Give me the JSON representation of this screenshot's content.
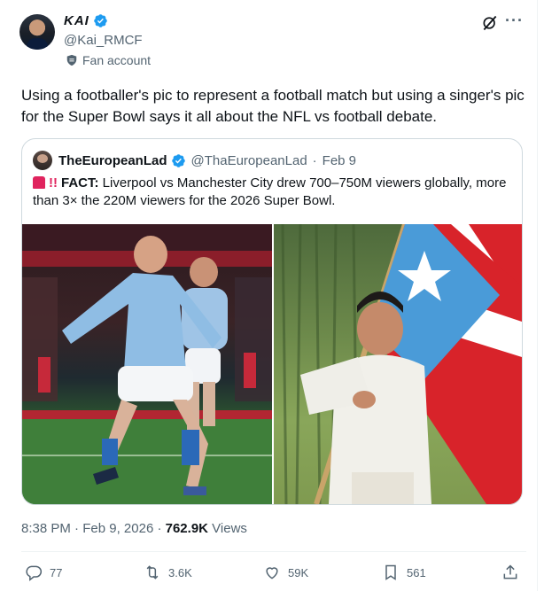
{
  "author": {
    "display_name": "KAI",
    "handle": "@Kai_RMCF",
    "label": "Fan account"
  },
  "tweet": {
    "text": "Using a footballer's pic to represent a football match but using a singer's pic for the Super Bowl says it all about the NFL vs football debate."
  },
  "quote": {
    "name": "TheEuropeanLad",
    "handle": "@ThaEuropeanLad",
    "separator": "·",
    "date": "Feb 9",
    "prefix": "!!",
    "fact_label": "FACT:",
    "text": "Liverpool vs Manchester City drew 700–750M viewers globally, more than 3× the 220M viewers for the 2026 Super Bowl.",
    "images": [
      "football-celebration-photo",
      "singer-with-flag-photo"
    ]
  },
  "meta": {
    "time": "8:38 PM",
    "sep1": "·",
    "date": "Feb 9, 2026",
    "sep2": "·",
    "views_count": "762.9K",
    "views_label": "Views"
  },
  "actions": {
    "replies": "77",
    "reposts": "3.6K",
    "likes": "59K",
    "bookmarks": "561"
  },
  "colors": {
    "verified": "#1d9bf0",
    "text": "#0f1419",
    "secondary": "#536471",
    "border": "#cfd9de"
  },
  "icons": [
    "verified-badge-icon",
    "fan-badge-icon",
    "grok-icon",
    "more-icon",
    "reply-icon",
    "repost-icon",
    "like-icon",
    "bookmark-icon",
    "share-icon"
  ]
}
